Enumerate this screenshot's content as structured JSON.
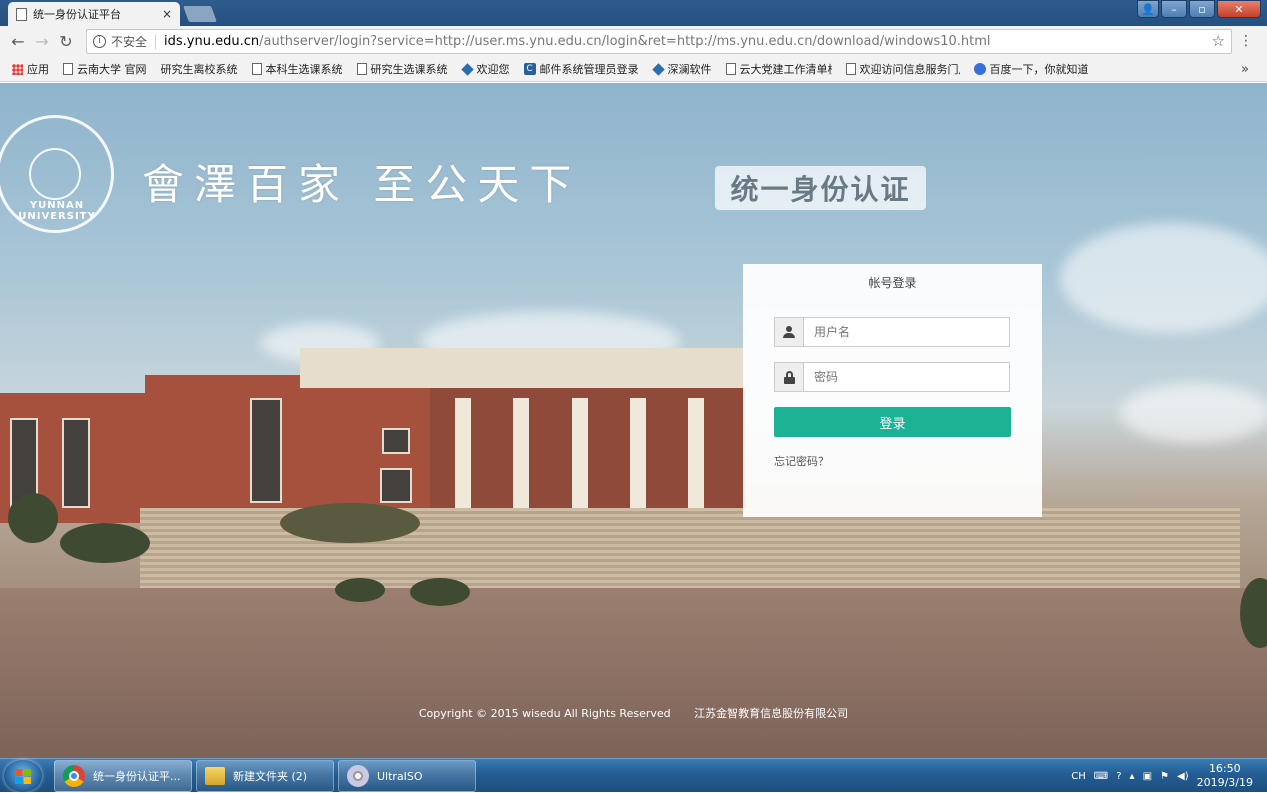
{
  "browser": {
    "tab_title": "统一身份认证平台",
    "tab_close": "×",
    "security_label": "不安全",
    "url_host": "ids.ynu.edu.cn",
    "url_rest": "/authserver/login?service=http://user.ms.ynu.edu.cn/login&ret=http://ms.ynu.edu.cn/download/windows10.html",
    "bookmarks": [
      {
        "label": "应用",
        "icon": "apps-grid-icon"
      },
      {
        "label": "云南大学 官网",
        "icon": "page-icon"
      },
      {
        "label": "研究生离校系统",
        "icon": "none"
      },
      {
        "label": "本科生选课系统",
        "icon": "page-icon"
      },
      {
        "label": "研究生选课系统",
        "icon": "page-icon"
      },
      {
        "label": "欢迎您",
        "icon": "diamond-icon"
      },
      {
        "label": "邮件系统管理员登录",
        "icon": "coremail-icon"
      },
      {
        "label": "深澜软件",
        "icon": "diamond-icon"
      },
      {
        "label": "云大党建工作清单栏目",
        "icon": "page-icon"
      },
      {
        "label": "欢迎访问信息服务门户",
        "icon": "page-icon"
      },
      {
        "label": "百度一下，你就知道",
        "icon": "baidu-paw-icon"
      }
    ],
    "more_bookmarks": "»"
  },
  "page": {
    "emblem_text": "YUNNAN UNIVERSITY",
    "slogan": "會澤百家  至公天下",
    "badge": "统一身份认证",
    "login": {
      "title": "帐号登录",
      "username_placeholder": "用户名",
      "password_placeholder": "密码",
      "submit_label": "登录",
      "forgot_label": "忘记密码？"
    },
    "footer": {
      "copyright": "Copyright © 2015 wisedu All Rights Reserved",
      "company": "江苏金智教育信息股份有限公司"
    }
  },
  "taskbar": {
    "items": [
      {
        "label": "统一身份认证平...",
        "icon": "chrome-icon"
      },
      {
        "label": "新建文件夹 (2)",
        "icon": "folder-icon"
      },
      {
        "label": "UltraISO",
        "icon": "disc-icon"
      }
    ],
    "tray": {
      "lang": "CH",
      "time": "16:50",
      "date": "2019/3/19"
    }
  }
}
